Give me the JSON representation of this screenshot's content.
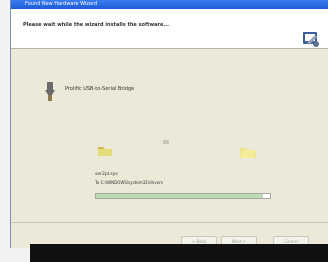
{
  "window": {
    "title": "Found New Hardware Wizard"
  },
  "header": {
    "instruction": "Please wait while the wizard installs the software..."
  },
  "device": {
    "name": "Prolific USB-to-Serial Bridge"
  },
  "progress": {
    "file_name": "ser2pl.sys",
    "path": "To C:\\WINDOWS\\system32\\drivers",
    "percent": 96
  },
  "buttons": {
    "back": "< Back",
    "next": "Next >",
    "cancel": "Cancel"
  }
}
